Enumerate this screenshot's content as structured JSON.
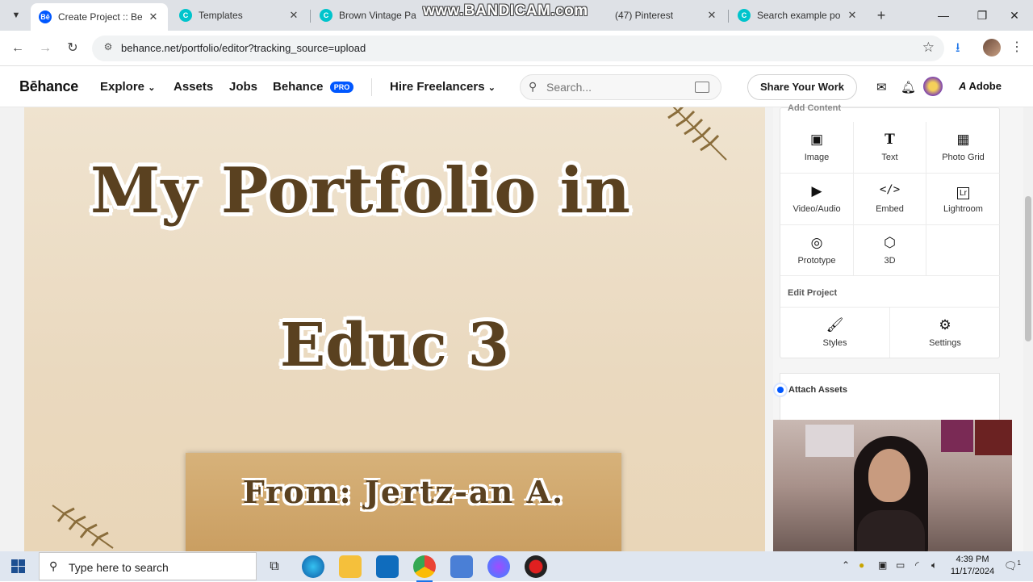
{
  "browser": {
    "tabs": [
      {
        "title": "Create Project :: Behance",
        "active": true
      },
      {
        "title": "Templates",
        "active": false
      },
      {
        "title": "Brown Vintage Paper",
        "active": false
      },
      {
        "title": "(47) Pinterest",
        "active": false
      },
      {
        "title": "Search example portfolio",
        "active": false
      }
    ],
    "watermark": "www.BANDICAM.com",
    "url": "behance.net/portfolio/editor?tracking_source=upload"
  },
  "behance": {
    "logo": "Bēhance",
    "nav": {
      "explore": "Explore",
      "assets": "Assets",
      "jobs": "Jobs",
      "behance": "Behance",
      "pro_badge": "PRO",
      "hire": "Hire Freelancers"
    },
    "search_placeholder": "Search...",
    "share_button": "Share Your Work",
    "adobe": "Adobe"
  },
  "canvas": {
    "title_line1": "My Portfolio in",
    "title_line2": "Educ 3",
    "from_line": "From: Jertz-an A."
  },
  "panel": {
    "add_content_title": "Add Content",
    "add_content_items": [
      {
        "label": "Image",
        "icon": "image-icon"
      },
      {
        "label": "Text",
        "icon": "text-icon"
      },
      {
        "label": "Photo Grid",
        "icon": "photo-grid-icon"
      },
      {
        "label": "Video/Audio",
        "icon": "play-icon"
      },
      {
        "label": "Embed",
        "icon": "code-icon"
      },
      {
        "label": "Lightroom",
        "icon": "lightroom-icon"
      },
      {
        "label": "Prototype",
        "icon": "cursor-icon"
      },
      {
        "label": "3D",
        "icon": "cube-icon"
      }
    ],
    "edit_project_title": "Edit Project",
    "edit_items": [
      {
        "label": "Styles",
        "icon": "brush-icon"
      },
      {
        "label": "Settings",
        "icon": "gear-icon"
      }
    ],
    "attach_assets": "Attach Assets"
  },
  "taskbar": {
    "search_placeholder": "Type here to search",
    "time": "4:39 PM",
    "date": "11/17/2024",
    "notification_count": "1"
  }
}
